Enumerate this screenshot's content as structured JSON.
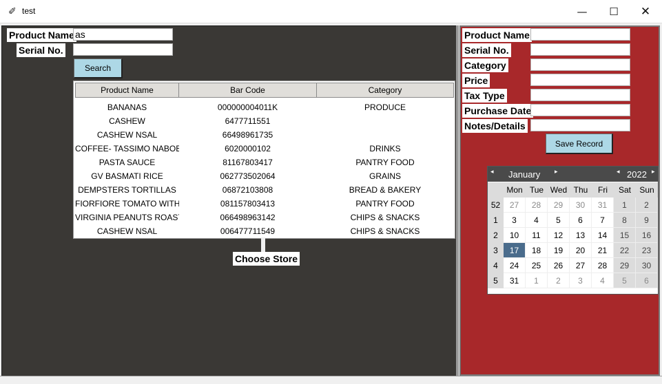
{
  "window": {
    "title": "test",
    "icon": "feather-icon",
    "controls": [
      "minimize-icon",
      "maximize-icon",
      "close-icon"
    ]
  },
  "search": {
    "product_name_label": "Product Name",
    "product_name_value": "as",
    "serial_label": "Serial No.",
    "serial_value": "",
    "search_button": "Search"
  },
  "results": {
    "columns": [
      "Product Name",
      "Bar Code",
      "Category"
    ],
    "rows": [
      [
        "BANANAS",
        "000000004011K",
        "PRODUCE"
      ],
      [
        "CASHEW",
        "6477711551",
        ""
      ],
      [
        "CASHEW NSAL",
        "66498961735",
        ""
      ],
      [
        "COFFEE- TASSIMO NABOB",
        "6020000102",
        "DRINKS"
      ],
      [
        "PASTA SAUCE",
        "81167803417",
        "PANTRY FOOD"
      ],
      [
        "GV BASMATI RICE",
        "062773502064",
        "GRAINS"
      ],
      [
        "DEMPSTERS TORTILLAS",
        "06872103808",
        "BREAD & BAKERY"
      ],
      [
        "FIORFIORE TOMATO WITH",
        "081157803413",
        "PANTRY FOOD"
      ],
      [
        "VIRGINIA PEANUTS ROASTI",
        "066498963142",
        "CHIPS & SNACKS"
      ],
      [
        "CASHEW NSAL",
        "006477711549",
        "CHIPS & SNACKS"
      ]
    ],
    "choose_store": "Choose Store"
  },
  "record": {
    "fields": [
      {
        "label": "Product Name",
        "value": ""
      },
      {
        "label": "Serial No.",
        "value": ""
      },
      {
        "label": "Category",
        "value": ""
      },
      {
        "label": "Price",
        "value": ""
      },
      {
        "label": "Tax Type",
        "value": ""
      },
      {
        "label": "Purchase Date",
        "value": ""
      },
      {
        "label": "Notes/Details",
        "value": ""
      }
    ],
    "save_button": "Save Record"
  },
  "calendar": {
    "month": "January",
    "year": "2022",
    "prev_month": "◂",
    "next_month": "▸",
    "prev_year": "◂",
    "next_year": "▸",
    "days_of_week": [
      "Mon",
      "Tue",
      "Wed",
      "Thu",
      "Fri",
      "Sat",
      "Sun"
    ],
    "weeks": [
      {
        "week": "52",
        "days": [
          "27",
          "28",
          "29",
          "30",
          "31",
          "1",
          "2"
        ],
        "other": [
          true,
          true,
          true,
          true,
          true,
          false,
          false
        ]
      },
      {
        "week": "1",
        "days": [
          "3",
          "4",
          "5",
          "6",
          "7",
          "8",
          "9"
        ],
        "other": [
          false,
          false,
          false,
          false,
          false,
          false,
          false
        ]
      },
      {
        "week": "2",
        "days": [
          "10",
          "11",
          "12",
          "13",
          "14",
          "15",
          "16"
        ],
        "other": [
          false,
          false,
          false,
          false,
          false,
          false,
          false
        ]
      },
      {
        "week": "3",
        "days": [
          "17",
          "18",
          "19",
          "20",
          "21",
          "22",
          "23"
        ],
        "other": [
          false,
          false,
          false,
          false,
          false,
          false,
          false
        ]
      },
      {
        "week": "4",
        "days": [
          "24",
          "25",
          "26",
          "27",
          "28",
          "29",
          "30"
        ],
        "other": [
          false,
          false,
          false,
          false,
          false,
          false,
          false
        ]
      },
      {
        "week": "5",
        "days": [
          "31",
          "1",
          "2",
          "3",
          "4",
          "5",
          "6"
        ],
        "other": [
          false,
          true,
          true,
          true,
          true,
          true,
          true
        ]
      }
    ],
    "selected_day": "17"
  },
  "colors": {
    "left_panel": "#3a3835",
    "right_panel": "#a8282a",
    "button": "#add8e6",
    "calendar_header": "#4a4a4a",
    "calendar_selected": "#4a6c8c"
  }
}
